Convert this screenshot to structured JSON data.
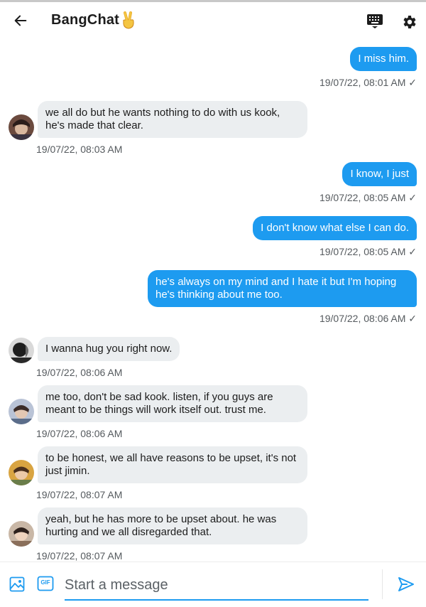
{
  "header": {
    "title": "BangChat",
    "title_emoji": "✌",
    "back_icon": "arrow-left-icon",
    "keyboard_icon": "keyboard-icon",
    "settings_icon": "gear-icon"
  },
  "messages": [
    {
      "dir": "out",
      "text": "I miss him.",
      "time": "19/07/22, 08:01 AM ✓"
    },
    {
      "dir": "in",
      "text": "we all do but he wants nothing to do with us kook, he's made that clear.",
      "time": "19/07/22, 08:03 AM"
    },
    {
      "dir": "out",
      "text": "I know, I just",
      "time": "19/07/22, 08:05 AM ✓"
    },
    {
      "dir": "out",
      "text": "I don't know what else I can do.",
      "time": "19/07/22, 08:05 AM ✓"
    },
    {
      "dir": "out",
      "text": "he's always on my mind and I hate it but I'm hoping he's thinking about me too.",
      "time": "19/07/22, 08:06 AM ✓"
    },
    {
      "dir": "in",
      "text": "I wanna hug you right now.",
      "time": "19/07/22, 08:06 AM"
    },
    {
      "dir": "in",
      "text": "me too, don't be sad kook. listen, if you guys are meant to be things will work itself out. trust me.",
      "time": "19/07/22, 08:06 AM"
    },
    {
      "dir": "in",
      "text": "to be honest, we all have reasons to be upset, it's not just jimin.",
      "time": "19/07/22, 08:07 AM"
    },
    {
      "dir": "in",
      "text": "yeah, but he has more to be upset about. he was hurting and we all disregarded that.",
      "time": "19/07/22, 08:07 AM"
    }
  ],
  "composer": {
    "placeholder": "Start a message",
    "value": "",
    "image_icon": "image-icon",
    "gif_icon": "gif-icon",
    "gif_label": "GIF",
    "send_icon": "send-icon"
  },
  "colors": {
    "accent": "#1d9bf0",
    "incoming_bubble": "#ebeef0",
    "text": "#1c1c1c",
    "timestamp": "#555a5e"
  }
}
